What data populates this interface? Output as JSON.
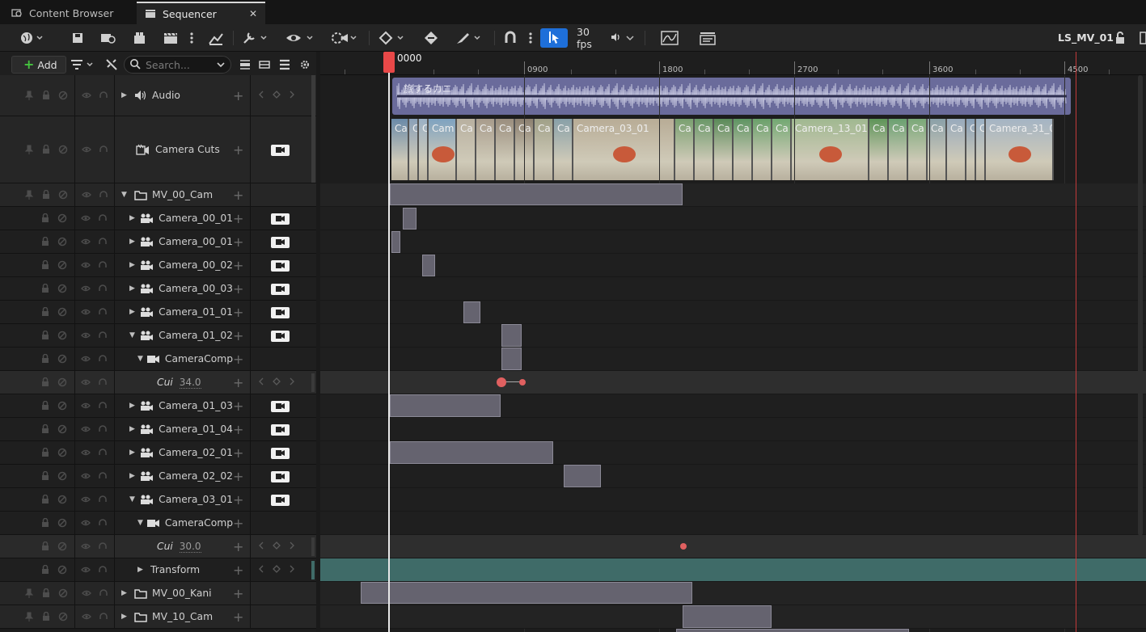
{
  "tabs": [
    {
      "label": "Content Browser",
      "active": false
    },
    {
      "label": "Sequencer",
      "active": true
    }
  ],
  "toolbar": {
    "fps_label": "30 fps",
    "sequence_name": "LS_MV_01",
    "icons": [
      "world-icon",
      "save-icon",
      "browse-icon",
      "camera-add-icon",
      "clapper-icon",
      "more-icon",
      "render-icon",
      "wrench-icon",
      "eye-icon",
      "play-filter-icon",
      "key-diamond-icon",
      "key-fill-icon",
      "brush-icon",
      "snap-magnet-icon",
      "more-icon",
      "cursor-select-icon",
      "audio-icon",
      "curve-editor-icon",
      "cinematic-icon",
      "lock-icon"
    ]
  },
  "outliner": {
    "add_label": "Add",
    "search_placeholder": "Search..."
  },
  "ruler": {
    "playhead_label": "0000",
    "ticks": [
      "0900",
      "1800",
      "2700",
      "3600",
      "4500"
    ]
  },
  "tracks": [
    {
      "name": "Audio",
      "kind": "audio",
      "expanded": false
    },
    {
      "name": "Camera Cuts",
      "kind": "cuts"
    },
    {
      "name": "MV_00_Cam",
      "kind": "folder",
      "expanded": true
    },
    {
      "name": "Camera_00_01",
      "kind": "camera"
    },
    {
      "name": "Camera_00_01",
      "kind": "camera"
    },
    {
      "name": "Camera_00_02",
      "kind": "camera"
    },
    {
      "name": "Camera_00_03",
      "kind": "camera"
    },
    {
      "name": "Camera_01_01",
      "kind": "camera"
    },
    {
      "name": "Camera_01_02",
      "kind": "camera",
      "expanded": true
    },
    {
      "name": "CameraComp",
      "kind": "component",
      "expanded": true
    },
    {
      "name": "Cui",
      "kind": "curve",
      "value": "34.0"
    },
    {
      "name": "Camera_01_03",
      "kind": "camera"
    },
    {
      "name": "Camera_01_04",
      "kind": "camera"
    },
    {
      "name": "Camera_02_01",
      "kind": "camera"
    },
    {
      "name": "Camera_02_02",
      "kind": "camera"
    },
    {
      "name": "Camera_03_01",
      "kind": "camera",
      "expanded": true
    },
    {
      "name": "CameraComp",
      "kind": "component",
      "expanded": true
    },
    {
      "name": "Cui",
      "kind": "curve",
      "value": "30.0"
    },
    {
      "name": "Transform",
      "kind": "transform"
    },
    {
      "name": "MV_00_Kani",
      "kind": "folder"
    },
    {
      "name": "MV_10_Cam",
      "kind": "folder"
    }
  ],
  "audio_clip": {
    "label": "旅するカニ",
    "color": "#6a6b9b"
  },
  "camera_cuts": [
    {
      "label": "Car"
    },
    {
      "label": "C"
    },
    {
      "label": "C"
    },
    {
      "label": "Cam"
    },
    {
      "label": "Ca"
    },
    {
      "label": "Ca"
    },
    {
      "label": "Ca"
    },
    {
      "label": "Ca"
    },
    {
      "label": "Ca"
    },
    {
      "label": "Ca"
    },
    {
      "label": "Camera_03_01"
    },
    {
      "label": "Ca"
    },
    {
      "label": "Ca"
    },
    {
      "label": "Ca"
    },
    {
      "label": "Ca"
    },
    {
      "label": "Ca"
    },
    {
      "label": "Ca"
    },
    {
      "label": "Camera_13_01"
    },
    {
      "label": "Ca"
    },
    {
      "label": "Ca"
    },
    {
      "label": "Ca"
    },
    {
      "label": "Ca"
    },
    {
      "label": "Ca"
    },
    {
      "label": "Ca"
    },
    {
      "label": "C"
    },
    {
      "label": "Camera_31_0"
    }
  ],
  "colors": {
    "accent": "#1e6fd9",
    "playhead": "#e84848",
    "end_marker": "#c23a3a",
    "section": "#65636f",
    "transform_track": "#3f6b68",
    "audio": "#6a6b9b"
  }
}
